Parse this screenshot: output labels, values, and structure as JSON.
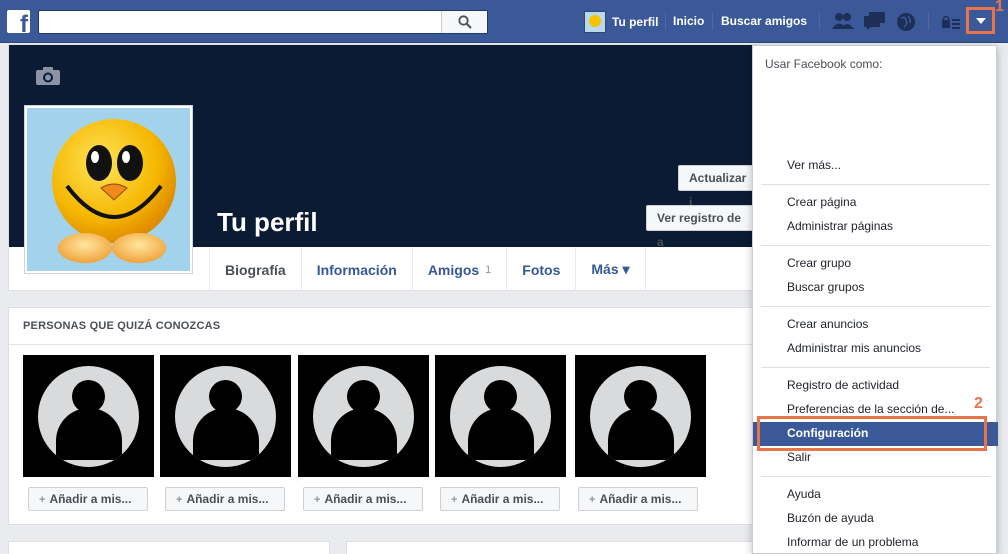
{
  "topbar": {
    "logo": "f",
    "profile_label": "Tu perfil",
    "home_label": "Inicio",
    "find_friends_label": "Buscar amigos"
  },
  "annotations": {
    "marker1": "1",
    "marker2": "2"
  },
  "profile": {
    "name": "Tu perfil",
    "update_button": "Actualizar i",
    "activity_button": "Ver registro de a"
  },
  "tabs": [
    {
      "label": "Biografía"
    },
    {
      "label": "Información"
    },
    {
      "label": "Amigos",
      "count": "1"
    },
    {
      "label": "Fotos"
    },
    {
      "label": "Más ▾"
    }
  ],
  "pymk": {
    "title": "PERSONAS QUE QUIZÁ CONOZCAS",
    "add_label": "Añadir a mis...",
    "add_icon": "+"
  },
  "dropdown": {
    "header": "Usar Facebook como:",
    "items": [
      "Ver más...",
      "Crear página",
      "Administrar páginas",
      "Crear grupo",
      "Buscar grupos",
      "Crear anuncios",
      "Administrar mis anuncios",
      "Registro de actividad",
      "Preferencias de la sección de...",
      "Configuración",
      "Salir",
      "Ayuda",
      "Buzón de ayuda",
      "Informar de un problema"
    ]
  },
  "colors": {
    "brand": "#3b5998",
    "annotation": "#e8744a",
    "cover": "#0b1b33"
  },
  "icons": [
    "facebook-logo-icon",
    "search-icon",
    "friend-requests-icon",
    "messages-icon",
    "notifications-icon",
    "privacy-icon",
    "account-menu-arrow-icon",
    "camera-icon",
    "add-friend-icon"
  ]
}
